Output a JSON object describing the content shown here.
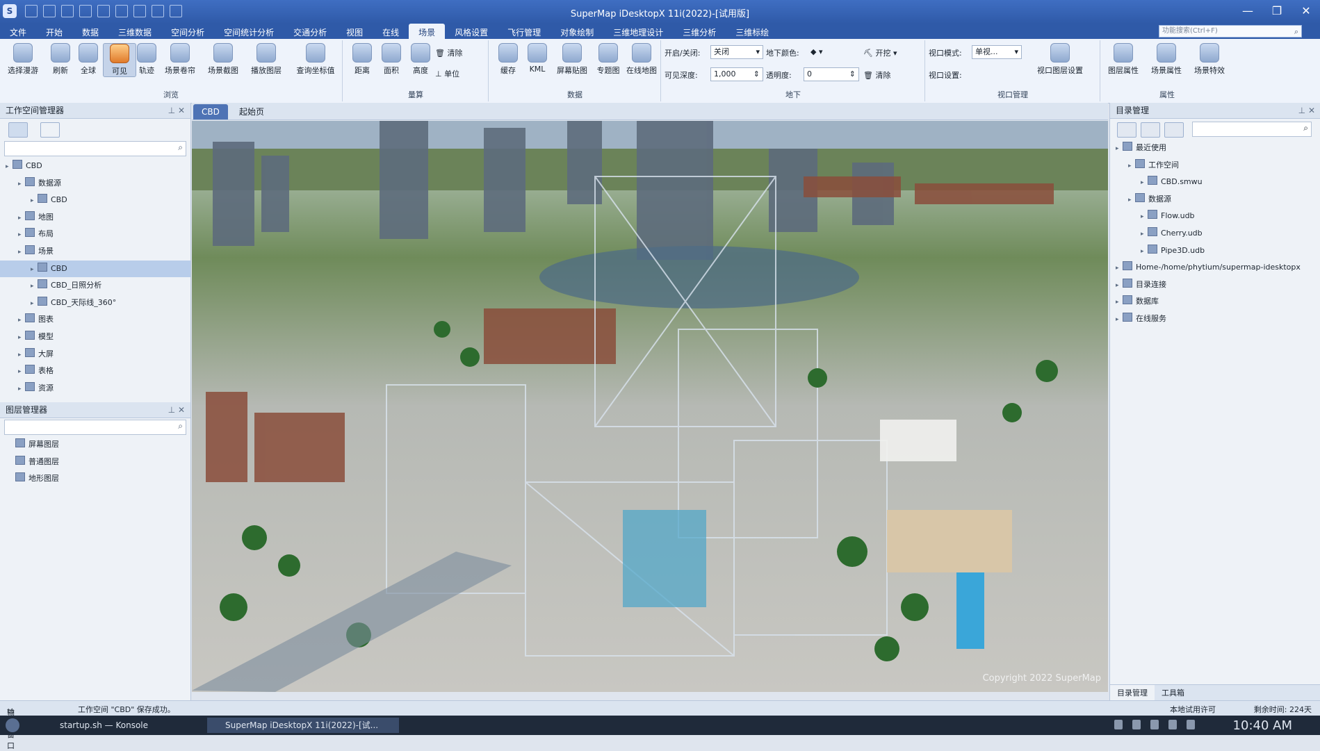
{
  "app": {
    "title": "SuperMap iDesktopX 11i(2022)-[试用版]"
  },
  "menu": {
    "items": [
      "文件",
      "开始",
      "数据",
      "三维数据",
      "空间分析",
      "空间统计分析",
      "交通分析",
      "视图",
      "在线",
      "场景",
      "风格设置",
      "飞行管理",
      "对象绘制",
      "三维地理设计",
      "三维分析",
      "三维标绘"
    ],
    "active": "场景"
  },
  "search": {
    "placeholder": "功能搜索(Ctrl+F)"
  },
  "ribbon": {
    "browse": {
      "label": "浏览",
      "buttons": [
        "选择漫游",
        "刷新",
        "全球",
        "可见",
        "轨迹",
        "场景卷帘",
        "场景截图",
        "播放图层",
        "查询坐标值"
      ]
    },
    "measure": {
      "label": "量算",
      "buttons": [
        "距离",
        "面积",
        "高度"
      ],
      "clear": "清除",
      "unit": "单位"
    },
    "data": {
      "label": "数据",
      "buttons": [
        "缓存",
        "KML",
        "屏幕贴图",
        "专题图",
        "在线地图"
      ]
    },
    "underground": {
      "label": "地下",
      "onoff_label": "开启/关闭:",
      "onoff_value": "关闭",
      "depth_label": "可见深度:",
      "depth_value": "1,000",
      "color_label": "地下颜色:",
      "trans_label": "透明度:",
      "trans_value": "0",
      "dig": "开挖",
      "clear": "清除"
    },
    "viewport": {
      "label": "视口管理",
      "mode_label": "视口模式:",
      "mode_value": "单视...",
      "setting_label": "视口设置:",
      "layer_setting": "视口图层设置"
    },
    "props": {
      "label": "属性",
      "buttons": [
        "图层属性",
        "场景属性",
        "场景特效"
      ]
    }
  },
  "workspace": {
    "title": "工作空间管理器",
    "tree": [
      {
        "label": "CBD",
        "depth": 0,
        "icon": "workspace-icon"
      },
      {
        "label": "数据源",
        "depth": 1,
        "icon": "datasource-icon"
      },
      {
        "label": "CBD",
        "depth": 2,
        "icon": "database-icon"
      },
      {
        "label": "地图",
        "depth": 1,
        "icon": "map-icon"
      },
      {
        "label": "布局",
        "depth": 1,
        "icon": "layout-icon"
      },
      {
        "label": "场景",
        "depth": 1,
        "icon": "scene-icon"
      },
      {
        "label": "CBD",
        "depth": 2,
        "icon": "scene-icon",
        "selected": true
      },
      {
        "label": "CBD_日照分析",
        "depth": 2,
        "icon": "scene-icon"
      },
      {
        "label": "CBD_天际线_360°",
        "depth": 2,
        "icon": "scene-icon"
      },
      {
        "label": "图表",
        "depth": 1,
        "icon": "chart-icon"
      },
      {
        "label": "模型",
        "depth": 1,
        "icon": "model-icon"
      },
      {
        "label": "大屏",
        "depth": 1,
        "icon": "screen-icon"
      },
      {
        "label": "表格",
        "depth": 1,
        "icon": "table-icon"
      },
      {
        "label": "资源",
        "depth": 1,
        "icon": "folder-icon"
      }
    ]
  },
  "layers": {
    "title": "图层管理器",
    "items": [
      "屏幕图层",
      "普通图层",
      "地形图层"
    ]
  },
  "tabs": [
    "CBD",
    "起始页"
  ],
  "scene": {
    "copyright": "Copyright 2022 SuperMap"
  },
  "catalog": {
    "title": "目录管理",
    "tree": [
      {
        "label": "最近使用",
        "depth": 0
      },
      {
        "label": "工作空间",
        "depth": 1
      },
      {
        "label": "CBD.smwu",
        "depth": 2
      },
      {
        "label": "数据源",
        "depth": 1
      },
      {
        "label": "Flow.udb",
        "depth": 2
      },
      {
        "label": "Cherry.udb",
        "depth": 2
      },
      {
        "label": "Pipe3D.udb",
        "depth": 2
      },
      {
        "label": "Home-/home/phytium/supermap-idesktopx",
        "depth": 0
      },
      {
        "label": "目录连接",
        "depth": 0
      },
      {
        "label": "数据库",
        "depth": 0
      },
      {
        "label": "在线服务",
        "depth": 0
      }
    ],
    "bottom_tabs": [
      "目录管理",
      "工具箱"
    ]
  },
  "status": {
    "output": "输出窗口",
    "message": "工作空间 \"CBD\" 保存成功。",
    "license": "本地试用许可",
    "remaining": "剩余时间: 224天"
  },
  "taskbar": {
    "task1": "startup.sh — Konsole",
    "task2": "SuperMap iDesktopX 11i(2022)-[试...",
    "time": "10:40 AM"
  }
}
